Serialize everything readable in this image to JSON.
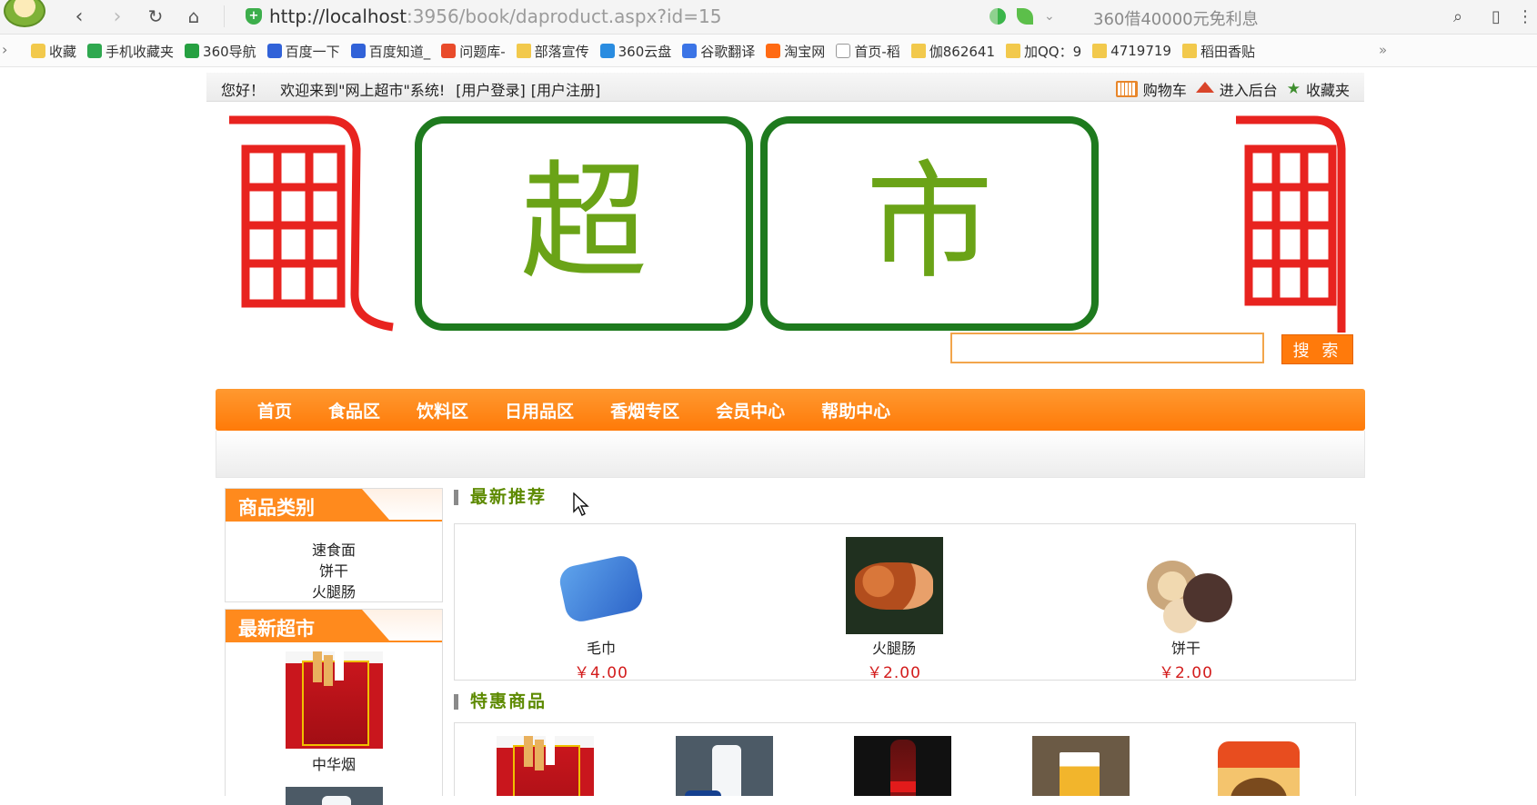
{
  "browser": {
    "url_host": "http://localhost",
    "url_rest": ":3956/book/daproduct.aspx?id=15",
    "ad_text": "360借40000元免利息",
    "bookmarks": [
      {
        "label": "收藏",
        "icon": "star-icon"
      },
      {
        "label": "手机收藏夹",
        "icon": "phone-icon"
      },
      {
        "label": "360导航",
        "icon": "globe-icon"
      },
      {
        "label": "百度一下",
        "icon": "paw-icon"
      },
      {
        "label": "百度知道_",
        "icon": "paw-icon"
      },
      {
        "label": "问题库-",
        "icon": "s-icon"
      },
      {
        "label": "部落宣传",
        "icon": "folder-icon"
      },
      {
        "label": "360云盘",
        "icon": "cloud-icon"
      },
      {
        "label": "谷歌翻译",
        "icon": "translate-icon"
      },
      {
        "label": "淘宝网",
        "icon": "taobao-icon"
      },
      {
        "label": "首页-稻",
        "icon": "page-icon"
      },
      {
        "label": "伽862641",
        "icon": "folder-icon"
      },
      {
        "label": "加QQ：9",
        "icon": "folder-icon"
      },
      {
        "label": "4719719",
        "icon": "folder-icon"
      },
      {
        "label": "稻田香贴",
        "icon": "folder-icon"
      }
    ]
  },
  "topbar": {
    "greeting": "您好！",
    "welcome": "欢迎来到\"网上超市\"系统!",
    "login": "[用户登录]",
    "register": "[用户注册]",
    "cart": "购物车",
    "admin": "进入后台",
    "favorites": "收藏夹"
  },
  "banner": {
    "char1": "超",
    "char2": "市",
    "colors": {
      "frame": "#1e7a1e",
      "text": "#6aa317",
      "cart": "#e8231f"
    }
  },
  "search": {
    "button": "搜 索",
    "value": ""
  },
  "nav": [
    "首页",
    "食品区",
    "饮料区",
    "日用品区",
    "香烟专区",
    "会员中心",
    "帮助中心"
  ],
  "sidebar": {
    "categories_title": "商品类别",
    "categories": [
      "速食面",
      "饼干",
      "火腿肠"
    ],
    "newest_title": "最新超市",
    "newest_item": "中华烟"
  },
  "recommend": {
    "title": "最新推荐",
    "items": [
      {
        "name": "毛巾",
        "price": "￥4.00",
        "img": "towel"
      },
      {
        "name": "火腿肠",
        "price": "￥2.00",
        "img": "ham"
      },
      {
        "name": "饼干",
        "price": "￥2.00",
        "img": "biscuit"
      }
    ]
  },
  "specials": {
    "title": "特惠商品",
    "items": [
      "cigarettes",
      "nivea",
      "cola",
      "beer",
      "noodles"
    ]
  },
  "accent_colors": {
    "orange": "#ff7a08",
    "price_red": "#d31c1c",
    "section_green": "#5d8a00"
  }
}
